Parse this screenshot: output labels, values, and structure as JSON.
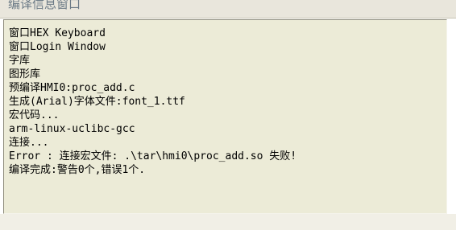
{
  "window": {
    "title": "编译信息窗口"
  },
  "log": {
    "lines": [
      "窗口HEX Keyboard",
      "窗口Login Window",
      "字库",
      "图形库",
      "预编译HMI0:proc_add.c",
      "生成(Arial)字体文件:font_1.ttf",
      "宏代码...",
      "arm-linux-uclibc-gcc",
      "连接...",
      "Error : 连接宏文件: .\\tar\\hmi0\\proc_add.so 失败!",
      "编译完成:警告0个,错误1个."
    ]
  }
}
